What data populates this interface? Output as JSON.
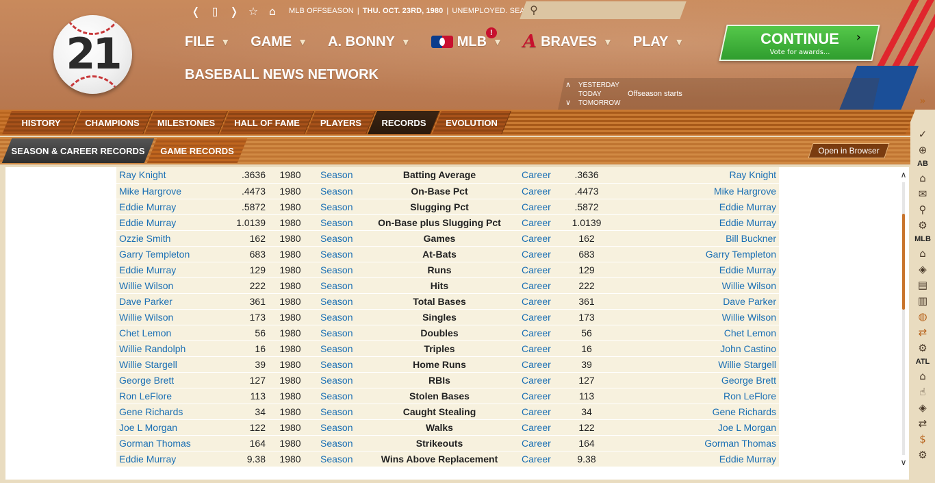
{
  "logo": {
    "number": "21"
  },
  "topbar": {
    "back_icon": "back-icon",
    "calendar_icon": "calendar-icon",
    "forward_icon": "forward-icon",
    "star_icon": "star-icon",
    "home_icon": "home-icon",
    "league_status": "MLB OFFSEASON",
    "date": "THU. OCT. 23RD, 1980",
    "status": "UNEMPLOYED. SEARCH JOBS...",
    "search_placeholder": ""
  },
  "mainnav": {
    "file": "FILE",
    "game": "GAME",
    "manager": "A. BONNY",
    "mlb": "MLB",
    "mlb_badge": "!",
    "braves": "BRAVES",
    "play": "PLAY"
  },
  "page": {
    "title": "BASEBALL NEWS NETWORK"
  },
  "continue_button": {
    "label": "CONTINUE",
    "sublabel": "Vote for awards...",
    "arrow": "›"
  },
  "days": {
    "yesterday": "YESTERDAY",
    "today": "TODAY",
    "tomorrow": "TOMORROW",
    "today_event": "Offseason starts"
  },
  "tabs": [
    "HISTORY",
    "CHAMPIONS",
    "MILESTONES",
    "HALL OF FAME",
    "PLAYERS",
    "RECORDS",
    "EVOLUTION"
  ],
  "subtabs": [
    "SEASON & CAREER RECORDS",
    "GAME RECORDS"
  ],
  "open_browser": "Open in Browser",
  "records": [
    {
      "season_player": "Ray Knight",
      "season_value": ".3636",
      "year": "1980",
      "season_label": "Season",
      "stat": "Batting Average",
      "career_label": "Career",
      "career_value": ".3636",
      "career_player": "Ray Knight"
    },
    {
      "season_player": "Mike Hargrove",
      "season_value": ".4473",
      "year": "1980",
      "season_label": "Season",
      "stat": "On-Base Pct",
      "career_label": "Career",
      "career_value": ".4473",
      "career_player": "Mike Hargrove"
    },
    {
      "season_player": "Eddie Murray",
      "season_value": ".5872",
      "year": "1980",
      "season_label": "Season",
      "stat": "Slugging Pct",
      "career_label": "Career",
      "career_value": ".5872",
      "career_player": "Eddie Murray"
    },
    {
      "season_player": "Eddie Murray",
      "season_value": "1.0139",
      "year": "1980",
      "season_label": "Season",
      "stat": "On-Base plus Slugging Pct",
      "career_label": "Career",
      "career_value": "1.0139",
      "career_player": "Eddie Murray"
    },
    {
      "season_player": "Ozzie Smith",
      "season_value": "162",
      "year": "1980",
      "season_label": "Season",
      "stat": "Games",
      "career_label": "Career",
      "career_value": "162",
      "career_player": "Bill Buckner"
    },
    {
      "season_player": "Garry Templeton",
      "season_value": "683",
      "year": "1980",
      "season_label": "Season",
      "stat": "At-Bats",
      "career_label": "Career",
      "career_value": "683",
      "career_player": "Garry Templeton"
    },
    {
      "season_player": "Eddie Murray",
      "season_value": "129",
      "year": "1980",
      "season_label": "Season",
      "stat": "Runs",
      "career_label": "Career",
      "career_value": "129",
      "career_player": "Eddie Murray"
    },
    {
      "season_player": "Willie Wilson",
      "season_value": "222",
      "year": "1980",
      "season_label": "Season",
      "stat": "Hits",
      "career_label": "Career",
      "career_value": "222",
      "career_player": "Willie Wilson"
    },
    {
      "season_player": "Dave Parker",
      "season_value": "361",
      "year": "1980",
      "season_label": "Season",
      "stat": "Total Bases",
      "career_label": "Career",
      "career_value": "361",
      "career_player": "Dave Parker"
    },
    {
      "season_player": "Willie Wilson",
      "season_value": "173",
      "year": "1980",
      "season_label": "Season",
      "stat": "Singles",
      "career_label": "Career",
      "career_value": "173",
      "career_player": "Willie Wilson"
    },
    {
      "season_player": "Chet Lemon",
      "season_value": "56",
      "year": "1980",
      "season_label": "Season",
      "stat": "Doubles",
      "career_label": "Career",
      "career_value": "56",
      "career_player": "Chet Lemon"
    },
    {
      "season_player": "Willie Randolph",
      "season_value": "16",
      "year": "1980",
      "season_label": "Season",
      "stat": "Triples",
      "career_label": "Career",
      "career_value": "16",
      "career_player": "John Castino"
    },
    {
      "season_player": "Willie Stargell",
      "season_value": "39",
      "year": "1980",
      "season_label": "Season",
      "stat": "Home Runs",
      "career_label": "Career",
      "career_value": "39",
      "career_player": "Willie Stargell"
    },
    {
      "season_player": "George Brett",
      "season_value": "127",
      "year": "1980",
      "season_label": "Season",
      "stat": "RBIs",
      "career_label": "Career",
      "career_value": "127",
      "career_player": "George Brett"
    },
    {
      "season_player": "Ron LeFlore",
      "season_value": "113",
      "year": "1980",
      "season_label": "Season",
      "stat": "Stolen Bases",
      "career_label": "Career",
      "career_value": "113",
      "career_player": "Ron LeFlore"
    },
    {
      "season_player": "Gene Richards",
      "season_value": "34",
      "year": "1980",
      "season_label": "Season",
      "stat": "Caught Stealing",
      "career_label": "Career",
      "career_value": "34",
      "career_player": "Gene Richards"
    },
    {
      "season_player": "Joe L Morgan",
      "season_value": "122",
      "year": "1980",
      "season_label": "Season",
      "stat": "Walks",
      "career_label": "Career",
      "career_value": "122",
      "career_player": "Joe L Morgan"
    },
    {
      "season_player": "Gorman Thomas",
      "season_value": "164",
      "year": "1980",
      "season_label": "Season",
      "stat": "Strikeouts",
      "career_label": "Career",
      "career_value": "164",
      "career_player": "Gorman Thomas"
    },
    {
      "season_player": "Eddie Murray",
      "season_value": "9.38",
      "year": "1980",
      "season_label": "Season",
      "stat": "Wins Above Replacement",
      "career_label": "Career",
      "career_value": "9.38",
      "career_player": "Eddie Murray"
    }
  ],
  "sidebar": {
    "section_ab": "AB",
    "section_mlb": "MLB",
    "section_atl": "ATL"
  },
  "colors": {
    "link": "#1a6fb4",
    "continue_green": "#3fae38",
    "header_brown": "#c0825a",
    "tab_orange": "#b8651f"
  }
}
